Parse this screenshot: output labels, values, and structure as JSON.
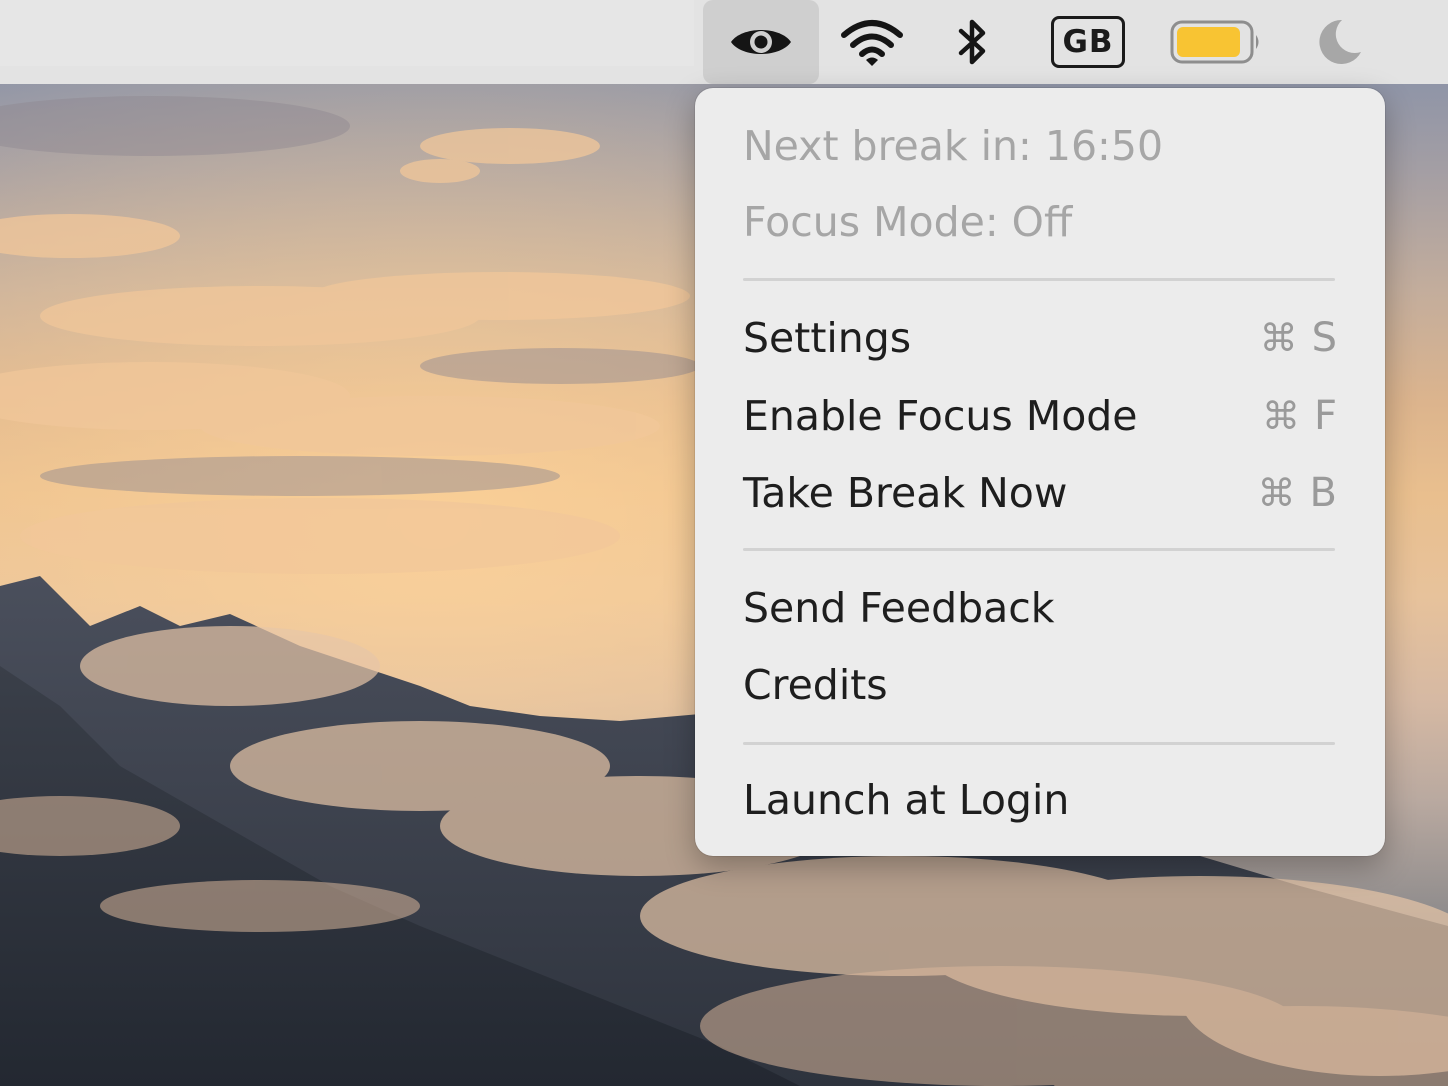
{
  "menubar": {
    "status_icons": [
      {
        "name": "eye-icon",
        "active": true
      },
      {
        "name": "wifi-icon"
      },
      {
        "name": "bluetooth-icon"
      },
      {
        "name": "keyboard-layout-icon",
        "label": "GB"
      },
      {
        "name": "battery-icon",
        "fill_percent": 90,
        "fill_color": "#f8c433"
      },
      {
        "name": "moon-icon"
      }
    ]
  },
  "menu": {
    "status": {
      "next_break": "Next break in: 16:50",
      "focus_mode": "Focus Mode: Off"
    },
    "actions": [
      {
        "label": "Settings",
        "shortcut_symbol": "⌘",
        "shortcut_key": "S"
      },
      {
        "label": "Enable Focus Mode",
        "shortcut_symbol": "⌘",
        "shortcut_key": "F"
      },
      {
        "label": "Take Break Now",
        "shortcut_symbol": "⌘",
        "shortcut_key": "B"
      }
    ],
    "links": [
      {
        "label": "Send Feedback"
      },
      {
        "label": "Credits"
      }
    ],
    "options": [
      {
        "label": "Launch at Login"
      }
    ]
  },
  "colors": {
    "menu_background": "#ececec",
    "disabled_text": "#a6a6a6",
    "battery_fill": "#f8c433"
  }
}
